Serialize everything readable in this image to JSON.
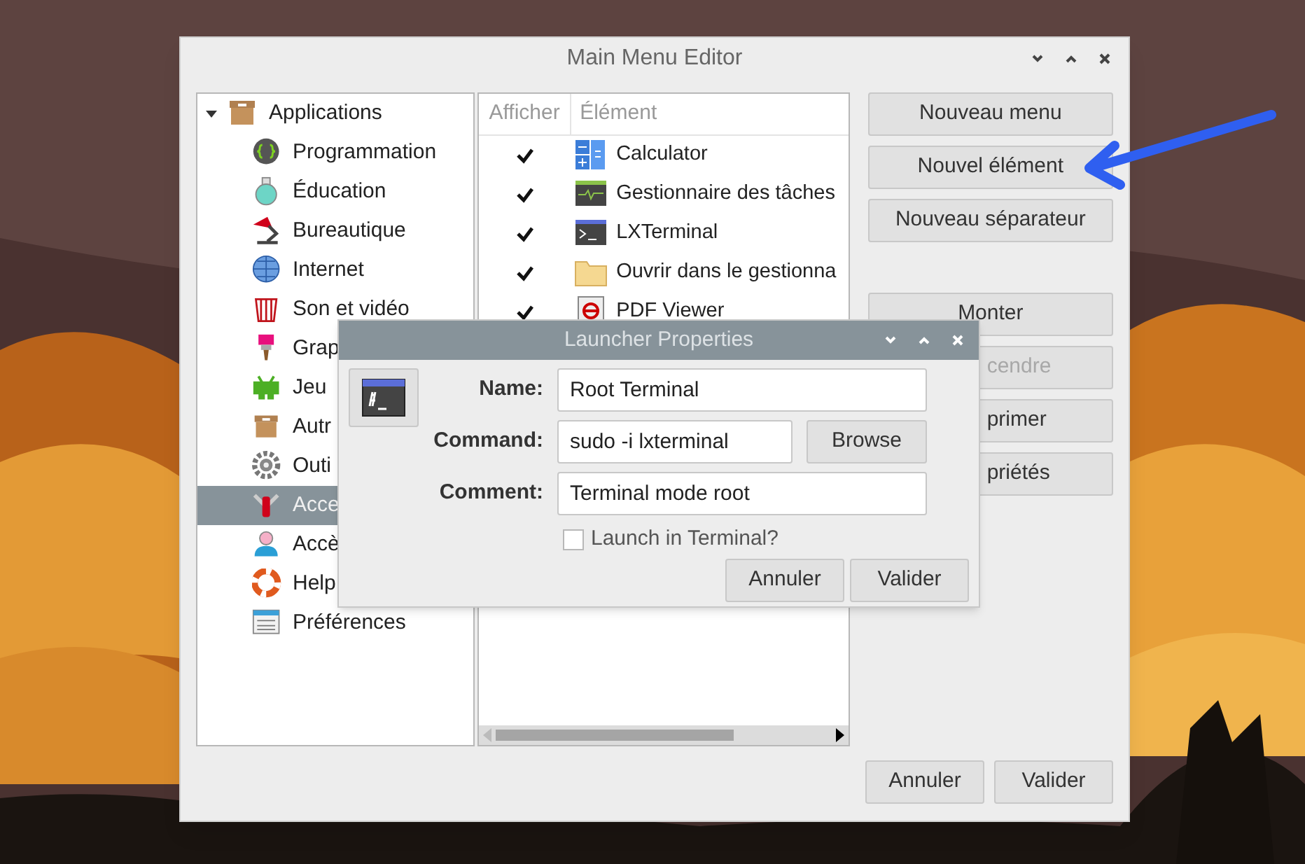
{
  "window": {
    "title": "Main Menu Editor"
  },
  "tree": {
    "label": "Applications",
    "expanded": true,
    "selected": false,
    "children": [
      {
        "label": "Programmation",
        "selected": false
      },
      {
        "label": "Éducation",
        "selected": false
      },
      {
        "label": "Bureautique",
        "selected": false
      },
      {
        "label": "Internet",
        "selected": false
      },
      {
        "label": "Son et vidéo",
        "selected": false
      },
      {
        "label": "Grap",
        "selected": false
      },
      {
        "label": "Jeu",
        "selected": false
      },
      {
        "label": "Autr",
        "selected": false
      },
      {
        "label": "Outi",
        "selected": false
      },
      {
        "label": "Acce",
        "selected": true
      },
      {
        "label": "Accè",
        "selected": false
      },
      {
        "label": "Help",
        "selected": false
      },
      {
        "label": "Préférences",
        "selected": false
      }
    ]
  },
  "list": {
    "columns": [
      "Afficher",
      "Élément"
    ],
    "rows": [
      {
        "shown": true,
        "label": "Calculator"
      },
      {
        "shown": true,
        "label": "Gestionnaire des tâches"
      },
      {
        "shown": true,
        "label": "LXTerminal"
      },
      {
        "shown": true,
        "label": "Ouvrir dans le gestionna"
      },
      {
        "shown": true,
        "label": "PDF Viewer"
      }
    ]
  },
  "buttons": [
    {
      "label": "Nouveau menu",
      "disabled": false
    },
    {
      "label": "Nouvel élément",
      "disabled": false
    },
    {
      "label": "Nouveau séparateur",
      "disabled": false
    }
  ],
  "move_buttons": [
    {
      "label": "Monter",
      "disabled": false
    },
    {
      "label": "cendre",
      "disabled": true
    },
    {
      "label": "primer",
      "disabled": false
    },
    {
      "label": "priétés",
      "disabled": false
    }
  ],
  "footer_buttons": [
    "Annuler",
    "Valider"
  ],
  "dialog": {
    "title": "Launcher Properties",
    "fields": [
      {
        "kind": "text",
        "label": "Name:",
        "value": "Root Terminal"
      },
      {
        "kind": "browse",
        "label": "Command:",
        "value": "sudo -i lxterminal",
        "button": "Browse"
      },
      {
        "kind": "text",
        "label": "Comment:",
        "value": "Terminal mode root"
      }
    ],
    "checkbox": {
      "label": "Launch in Terminal?",
      "checked": false
    },
    "buttons": [
      "Annuler",
      "Valider"
    ]
  }
}
